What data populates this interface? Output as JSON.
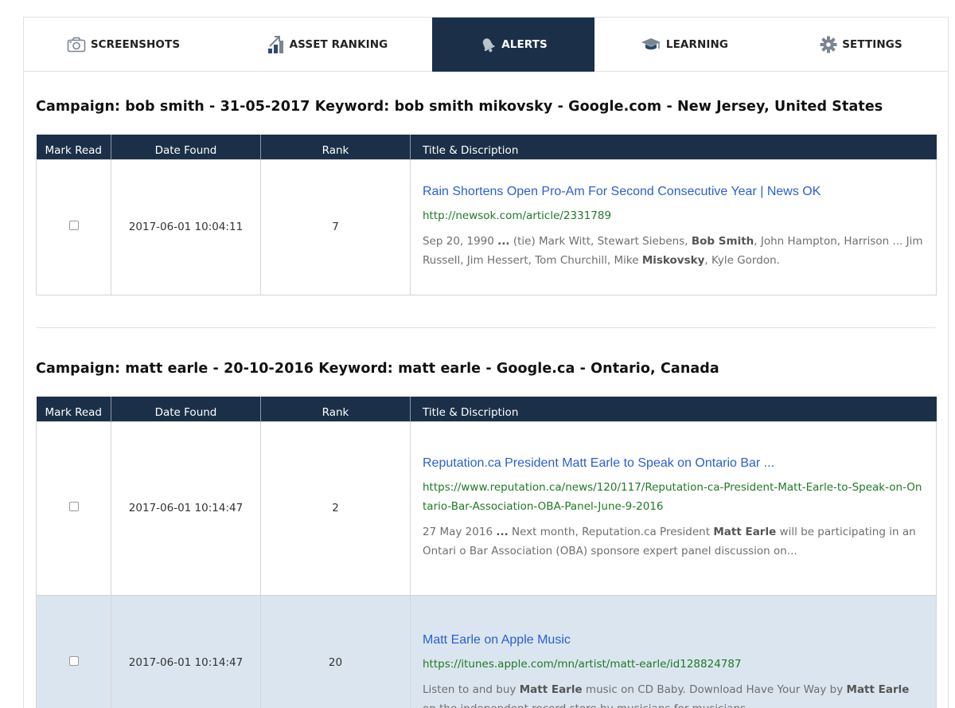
{
  "tabs": [
    {
      "label": "SCREENSHOTS",
      "icon": "camera-icon"
    },
    {
      "label": "ASSET RANKING",
      "icon": "ranking-chart-icon"
    },
    {
      "label": "ALERTS",
      "icon": "bell-icon",
      "active": true
    },
    {
      "label": "LEARNING",
      "icon": "graduation-cap-icon"
    },
    {
      "label": "SETTINGS",
      "icon": "gear-icon"
    }
  ],
  "columns": {
    "mark_read": "Mark Read",
    "date_found": "Date Found",
    "rank": "Rank",
    "title_desc": "Title & Discription"
  },
  "campaigns": [
    {
      "title": "Campaign: bob smith - 31-05-2017 Keyword: bob smith mikovsky - Google.com - New Jersey, United States",
      "rows": [
        {
          "date": "2017-06-01 10:04:11",
          "rank": "7",
          "title": "Rain Shortens Open Pro-Am For Second Consecutive Year | News OK",
          "url": "http://newsok.com/article/2331789",
          "snippet_parts": [
            {
              "t": "Sep 20, 1990 "
            },
            {
              "t": "...",
              "b": true
            },
            {
              "t": " (tie) Mark Witt, Stewart Siebens, "
            },
            {
              "t": "Bob Smith",
              "b": true
            },
            {
              "t": ", John Hampton, Harrison ... Jim Russell, Jim Hessert, Tom Churchill, Mike "
            },
            {
              "t": "Miskovsky",
              "b": true
            },
            {
              "t": ", Kyle Gordon."
            }
          ]
        }
      ]
    },
    {
      "title": "Campaign: matt earle - 20-10-2016 Keyword: matt earle - Google.ca - Ontario, Canada",
      "rows": [
        {
          "date": "2017-06-01 10:14:47",
          "rank": "2",
          "title": "Reputation.ca President Matt Earle to Speak on Ontario Bar ...",
          "url": "https://www.reputation.ca/news/120/117/Reputation-ca-President-Matt-Earle-to-Speak-on-Ontario-Bar-Association-OBA-Panel-June-9-2016",
          "snippet_parts": [
            {
              "t": "27 May 2016 "
            },
            {
              "t": "...",
              "b": true
            },
            {
              "t": " Next month, Reputation.ca President "
            },
            {
              "t": "Matt Earle",
              "b": true
            },
            {
              "t": " will be participating in an Ontari o Bar Association (OBA) sponsore expert panel discussion on..."
            }
          ]
        },
        {
          "date": "2017-06-01 10:14:47",
          "rank": "20",
          "title": "Matt Earle on Apple Music",
          "url": "https://itunes.apple.com/mn/artist/matt-earle/id128824787",
          "highlight": true,
          "snippet_parts": [
            {
              "t": "Listen to and buy "
            },
            {
              "t": "Matt Earle",
              "b": true
            },
            {
              "t": " music on CD Baby. Download Have Your Way by "
            },
            {
              "t": "Matt Earle",
              "b": true
            },
            {
              "t": " on the independent record store by musicians for musicians."
            }
          ]
        }
      ]
    }
  ],
  "colors": {
    "navy": "#1b3048",
    "link": "#2a5fd1",
    "url_green": "#1e7a24",
    "highlight_row": "#dbe5ef"
  }
}
